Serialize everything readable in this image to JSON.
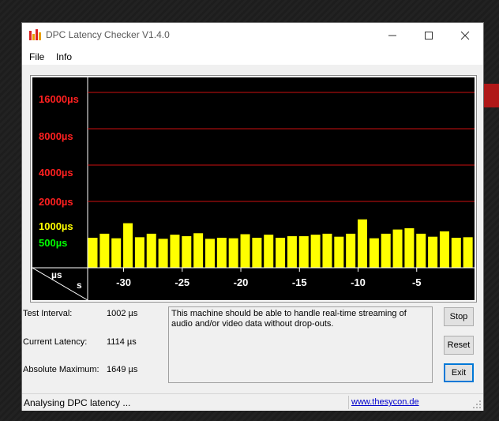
{
  "window": {
    "title": "DPC Latency Checker V1.4.0",
    "controls": {
      "minimize": "minimize",
      "maximize": "maximize",
      "close": "close"
    }
  },
  "menu": [
    "File",
    "Info"
  ],
  "chart_data": {
    "type": "bar",
    "x_unit_label": "s",
    "y_unit_label": "µs",
    "y_ticks": [
      {
        "label": "16000µs",
        "value": 16000,
        "color": "#ff2020"
      },
      {
        "label": "8000µs",
        "value": 8000,
        "color": "#ff2020"
      },
      {
        "label": "4000µs",
        "value": 4000,
        "color": "#ff2020"
      },
      {
        "label": "2000µs",
        "value": 2000,
        "color": "#ff2020"
      },
      {
        "label": "1000µs",
        "value": 1000,
        "color": "#ffff00"
      },
      {
        "label": "500µs",
        "value": 500,
        "color": "#00ff00"
      }
    ],
    "x_ticks": [
      -30,
      -25,
      -20,
      -15,
      -10,
      -5
    ],
    "x_range": [
      -33,
      0
    ],
    "scale": "log2",
    "values": [
      1000,
      1080,
      990,
      1320,
      1010,
      1080,
      980,
      1060,
      1030,
      1090,
      980,
      1000,
      990,
      1070,
      1000,
      1060,
      1000,
      1030,
      1030,
      1060,
      1080,
      1020,
      1080,
      1420,
      990,
      1080,
      1170,
      1200,
      1080,
      1020,
      1130,
      1000,
      1010
    ],
    "bar_color": "#ffff00",
    "grid_color": "#cc1010"
  },
  "stats": {
    "test_interval": {
      "label": "Test Interval:",
      "value": "1002 µs"
    },
    "current_latency": {
      "label": "Current Latency:",
      "value": "1114 µs"
    },
    "absolute_maximum": {
      "label": "Absolute Maximum:",
      "value": "1649 µs"
    }
  },
  "message": "This machine should be able to handle real-time streaming of audio and/or video data without drop-outs.",
  "buttons": {
    "stop": "Stop",
    "reset": "Reset",
    "exit": "Exit"
  },
  "status": {
    "text": "Analysing DPC latency ...",
    "link": "www.thesycon.de"
  }
}
